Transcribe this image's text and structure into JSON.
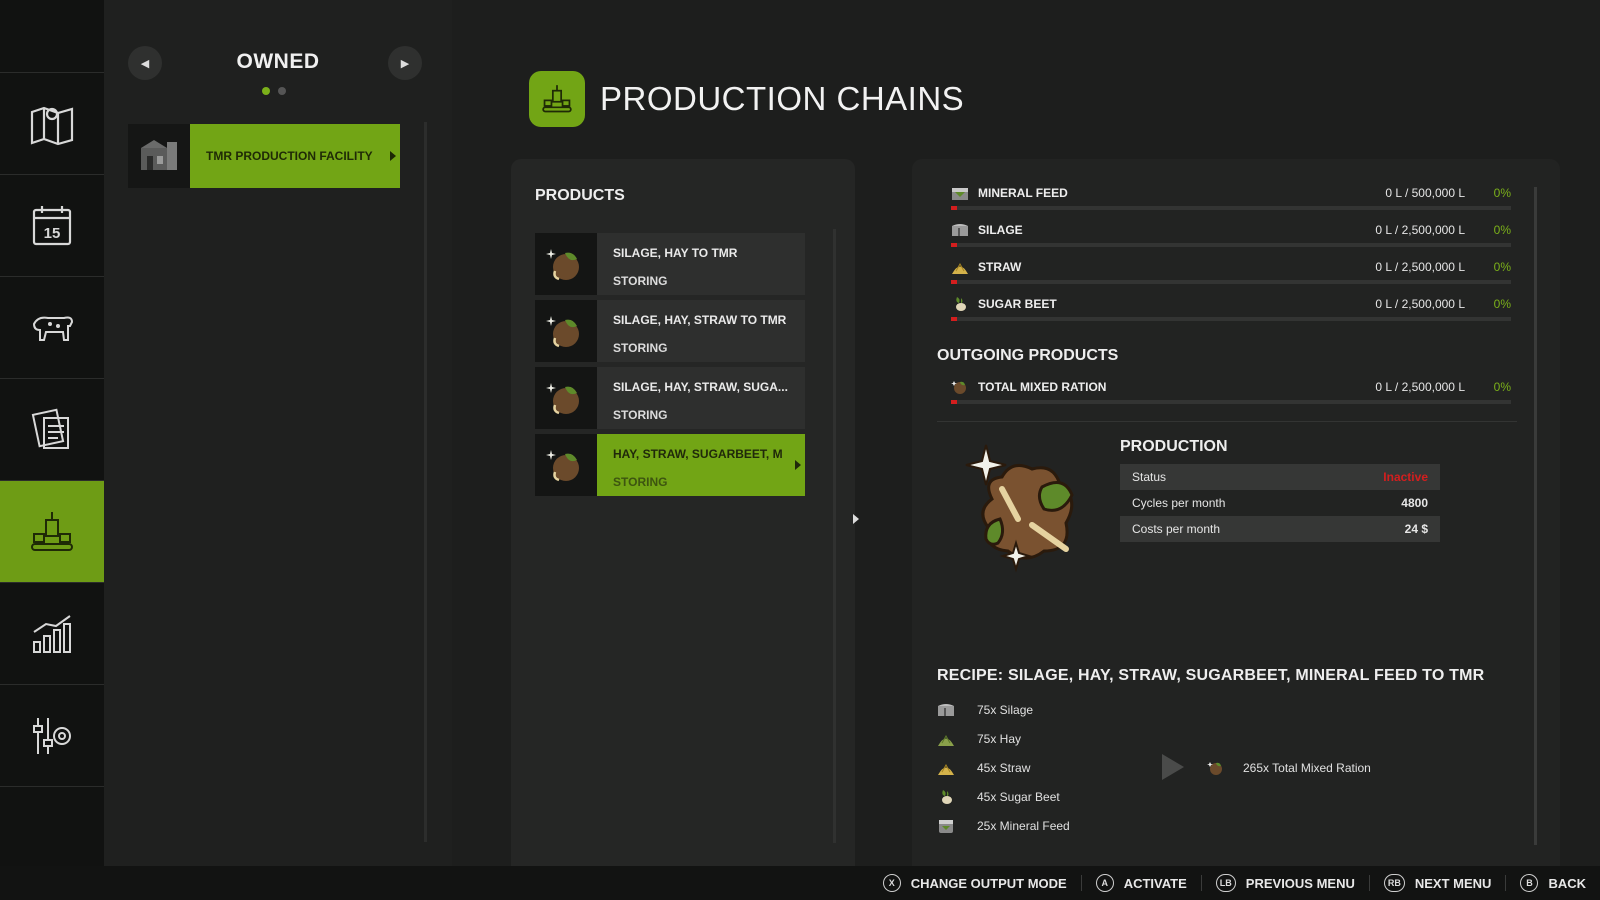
{
  "sidebar": {
    "items": [
      {
        "icon": "map-icon"
      },
      {
        "icon": "calendar-icon",
        "text": "15"
      },
      {
        "icon": "animals-icon"
      },
      {
        "icon": "contracts-icon"
      },
      {
        "icon": "production-icon"
      },
      {
        "icon": "statistics-icon"
      },
      {
        "icon": "settings-icon"
      }
    ],
    "active_index": 4
  },
  "owned": {
    "title": "OWNED",
    "page_count": 2,
    "current_page": 1,
    "facilities": [
      {
        "label": "TMR PRODUCTION FACILITY"
      }
    ]
  },
  "header": {
    "title": "PRODUCTION CHAINS"
  },
  "products": {
    "title": "PRODUCTS",
    "items": [
      {
        "name": "SILAGE, HAY TO TMR",
        "state": "STORING"
      },
      {
        "name": "SILAGE, HAY, STRAW TO TMR",
        "state": "STORING"
      },
      {
        "name": "SILAGE, HAY, STRAW, SUGA...",
        "state": "STORING"
      },
      {
        "name": "HAY, STRAW, SUGARBEET, M",
        "state": "STORING"
      }
    ],
    "selected_index": 3
  },
  "incoming": [
    {
      "name": "MINERAL FEED",
      "amount": "0 L / 500,000 L",
      "percent": "0%",
      "fill": 0
    },
    {
      "name": "SILAGE",
      "amount": "0 L / 2,500,000 L",
      "percent": "0%",
      "fill": 0
    },
    {
      "name": "STRAW",
      "amount": "0 L / 2,500,000 L",
      "percent": "0%",
      "fill": 0
    },
    {
      "name": "SUGAR BEET",
      "amount": "0 L / 2,500,000 L",
      "percent": "0%",
      "fill": 0
    }
  ],
  "outgoing": {
    "title": "OUTGOING PRODUCTS",
    "items": [
      {
        "name": "TOTAL MIXED RATION",
        "amount": "0 L / 2,500,000 L",
        "percent": "0%",
        "fill": 0
      }
    ]
  },
  "production": {
    "title": "PRODUCTION",
    "rows": [
      {
        "label": "Status",
        "value": "Inactive"
      },
      {
        "label": "Cycles per month",
        "value": "4800"
      },
      {
        "label": "Costs per month",
        "value": "24 $"
      }
    ]
  },
  "recipe": {
    "title": "RECIPE: SILAGE, HAY, STRAW, SUGARBEET, MINERAL FEED TO TMR",
    "inputs": [
      "75x Silage",
      "75x Hay",
      "45x Straw",
      "45x Sugar Beet",
      "25x Mineral Feed"
    ],
    "output": "265x Total Mixed Ration"
  },
  "hints": [
    {
      "button": "X",
      "label": "CHANGE OUTPUT MODE"
    },
    {
      "button": "A",
      "label": "ACTIVATE"
    },
    {
      "button": "LB",
      "label": "PREVIOUS MENU"
    },
    {
      "button": "RB",
      "label": "NEXT MENU"
    },
    {
      "button": "B",
      "label": "BACK"
    }
  ],
  "colors": {
    "accent": "#72a515",
    "alert": "#d41e1e",
    "percent": "#7bb01a"
  }
}
